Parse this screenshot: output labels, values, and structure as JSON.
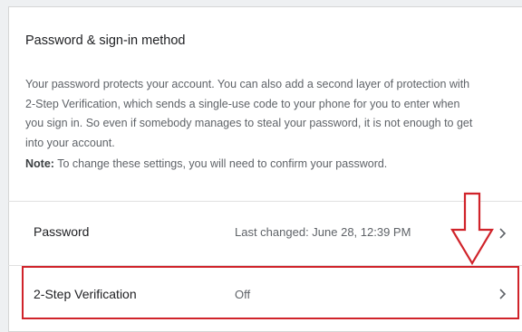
{
  "section": {
    "title": "Password & sign-in method",
    "description": "Your password protects your account. You can also add a second layer of protection with 2-Step Verification, which sends a single-use code to your phone for you to enter when you sign in. So even if somebody manages to steal your password, it is not enough to get into your account.",
    "note_label": "Note:",
    "note_text": " To change these settings, you will need to confirm your password."
  },
  "rows": [
    {
      "label": "Password",
      "value": "Last changed: June 28, 12:39 PM",
      "icon": "chevron-right-icon"
    },
    {
      "label": "2-Step Verification",
      "value": "Off",
      "icon": "chevron-right-icon"
    }
  ],
  "annotations": {
    "highlight_color": "#d0232a",
    "arrow_icon": "down-arrow-annotation"
  }
}
